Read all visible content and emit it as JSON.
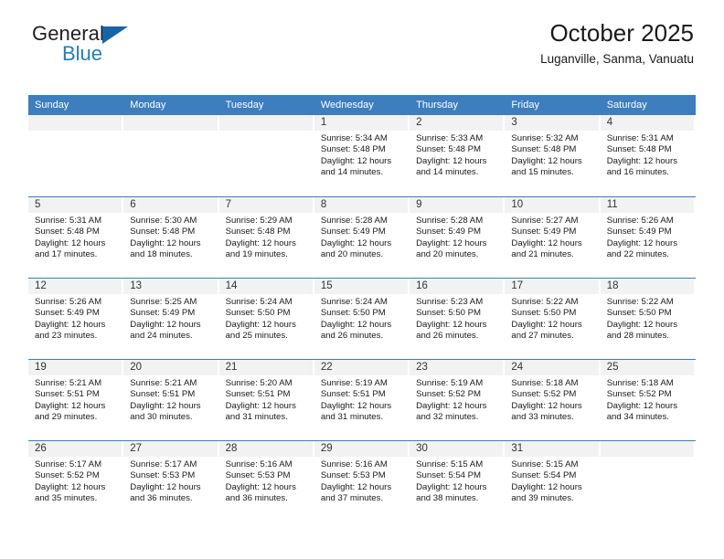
{
  "brand": {
    "name_part1": "General",
    "name_part2": "Blue"
  },
  "header": {
    "title": "October 2025",
    "subtitle": "Luganville, Sanma, Vanuatu"
  },
  "colors": {
    "header_blue": "#3d7ebe",
    "logo_blue": "#1f7ec4",
    "day_strip_gray": "#f2f2f2"
  },
  "weekdays": [
    "Sunday",
    "Monday",
    "Tuesday",
    "Wednesday",
    "Thursday",
    "Friday",
    "Saturday"
  ],
  "weeks": [
    [
      {
        "day": "",
        "empty": true
      },
      {
        "day": "",
        "empty": true
      },
      {
        "day": "",
        "empty": true
      },
      {
        "day": "1",
        "sunrise": "Sunrise: 5:34 AM",
        "sunset": "Sunset: 5:48 PM",
        "daylight1": "Daylight: 12 hours",
        "daylight2": "and 14 minutes."
      },
      {
        "day": "2",
        "sunrise": "Sunrise: 5:33 AM",
        "sunset": "Sunset: 5:48 PM",
        "daylight1": "Daylight: 12 hours",
        "daylight2": "and 14 minutes."
      },
      {
        "day": "3",
        "sunrise": "Sunrise: 5:32 AM",
        "sunset": "Sunset: 5:48 PM",
        "daylight1": "Daylight: 12 hours",
        "daylight2": "and 15 minutes."
      },
      {
        "day": "4",
        "sunrise": "Sunrise: 5:31 AM",
        "sunset": "Sunset: 5:48 PM",
        "daylight1": "Daylight: 12 hours",
        "daylight2": "and 16 minutes."
      }
    ],
    [
      {
        "day": "5",
        "sunrise": "Sunrise: 5:31 AM",
        "sunset": "Sunset: 5:48 PM",
        "daylight1": "Daylight: 12 hours",
        "daylight2": "and 17 minutes."
      },
      {
        "day": "6",
        "sunrise": "Sunrise: 5:30 AM",
        "sunset": "Sunset: 5:48 PM",
        "daylight1": "Daylight: 12 hours",
        "daylight2": "and 18 minutes."
      },
      {
        "day": "7",
        "sunrise": "Sunrise: 5:29 AM",
        "sunset": "Sunset: 5:48 PM",
        "daylight1": "Daylight: 12 hours",
        "daylight2": "and 19 minutes."
      },
      {
        "day": "8",
        "sunrise": "Sunrise: 5:28 AM",
        "sunset": "Sunset: 5:49 PM",
        "daylight1": "Daylight: 12 hours",
        "daylight2": "and 20 minutes."
      },
      {
        "day": "9",
        "sunrise": "Sunrise: 5:28 AM",
        "sunset": "Sunset: 5:49 PM",
        "daylight1": "Daylight: 12 hours",
        "daylight2": "and 20 minutes."
      },
      {
        "day": "10",
        "sunrise": "Sunrise: 5:27 AM",
        "sunset": "Sunset: 5:49 PM",
        "daylight1": "Daylight: 12 hours",
        "daylight2": "and 21 minutes."
      },
      {
        "day": "11",
        "sunrise": "Sunrise: 5:26 AM",
        "sunset": "Sunset: 5:49 PM",
        "daylight1": "Daylight: 12 hours",
        "daylight2": "and 22 minutes."
      }
    ],
    [
      {
        "day": "12",
        "sunrise": "Sunrise: 5:26 AM",
        "sunset": "Sunset: 5:49 PM",
        "daylight1": "Daylight: 12 hours",
        "daylight2": "and 23 minutes."
      },
      {
        "day": "13",
        "sunrise": "Sunrise: 5:25 AM",
        "sunset": "Sunset: 5:49 PM",
        "daylight1": "Daylight: 12 hours",
        "daylight2": "and 24 minutes."
      },
      {
        "day": "14",
        "sunrise": "Sunrise: 5:24 AM",
        "sunset": "Sunset: 5:50 PM",
        "daylight1": "Daylight: 12 hours",
        "daylight2": "and 25 minutes."
      },
      {
        "day": "15",
        "sunrise": "Sunrise: 5:24 AM",
        "sunset": "Sunset: 5:50 PM",
        "daylight1": "Daylight: 12 hours",
        "daylight2": "and 26 minutes."
      },
      {
        "day": "16",
        "sunrise": "Sunrise: 5:23 AM",
        "sunset": "Sunset: 5:50 PM",
        "daylight1": "Daylight: 12 hours",
        "daylight2": "and 26 minutes."
      },
      {
        "day": "17",
        "sunrise": "Sunrise: 5:22 AM",
        "sunset": "Sunset: 5:50 PM",
        "daylight1": "Daylight: 12 hours",
        "daylight2": "and 27 minutes."
      },
      {
        "day": "18",
        "sunrise": "Sunrise: 5:22 AM",
        "sunset": "Sunset: 5:50 PM",
        "daylight1": "Daylight: 12 hours",
        "daylight2": "and 28 minutes."
      }
    ],
    [
      {
        "day": "19",
        "sunrise": "Sunrise: 5:21 AM",
        "sunset": "Sunset: 5:51 PM",
        "daylight1": "Daylight: 12 hours",
        "daylight2": "and 29 minutes."
      },
      {
        "day": "20",
        "sunrise": "Sunrise: 5:21 AM",
        "sunset": "Sunset: 5:51 PM",
        "daylight1": "Daylight: 12 hours",
        "daylight2": "and 30 minutes."
      },
      {
        "day": "21",
        "sunrise": "Sunrise: 5:20 AM",
        "sunset": "Sunset: 5:51 PM",
        "daylight1": "Daylight: 12 hours",
        "daylight2": "and 31 minutes."
      },
      {
        "day": "22",
        "sunrise": "Sunrise: 5:19 AM",
        "sunset": "Sunset: 5:51 PM",
        "daylight1": "Daylight: 12 hours",
        "daylight2": "and 31 minutes."
      },
      {
        "day": "23",
        "sunrise": "Sunrise: 5:19 AM",
        "sunset": "Sunset: 5:52 PM",
        "daylight1": "Daylight: 12 hours",
        "daylight2": "and 32 minutes."
      },
      {
        "day": "24",
        "sunrise": "Sunrise: 5:18 AM",
        "sunset": "Sunset: 5:52 PM",
        "daylight1": "Daylight: 12 hours",
        "daylight2": "and 33 minutes."
      },
      {
        "day": "25",
        "sunrise": "Sunrise: 5:18 AM",
        "sunset": "Sunset: 5:52 PM",
        "daylight1": "Daylight: 12 hours",
        "daylight2": "and 34 minutes."
      }
    ],
    [
      {
        "day": "26",
        "sunrise": "Sunrise: 5:17 AM",
        "sunset": "Sunset: 5:52 PM",
        "daylight1": "Daylight: 12 hours",
        "daylight2": "and 35 minutes."
      },
      {
        "day": "27",
        "sunrise": "Sunrise: 5:17 AM",
        "sunset": "Sunset: 5:53 PM",
        "daylight1": "Daylight: 12 hours",
        "daylight2": "and 36 minutes."
      },
      {
        "day": "28",
        "sunrise": "Sunrise: 5:16 AM",
        "sunset": "Sunset: 5:53 PM",
        "daylight1": "Daylight: 12 hours",
        "daylight2": "and 36 minutes."
      },
      {
        "day": "29",
        "sunrise": "Sunrise: 5:16 AM",
        "sunset": "Sunset: 5:53 PM",
        "daylight1": "Daylight: 12 hours",
        "daylight2": "and 37 minutes."
      },
      {
        "day": "30",
        "sunrise": "Sunrise: 5:15 AM",
        "sunset": "Sunset: 5:54 PM",
        "daylight1": "Daylight: 12 hours",
        "daylight2": "and 38 minutes."
      },
      {
        "day": "31",
        "sunrise": "Sunrise: 5:15 AM",
        "sunset": "Sunset: 5:54 PM",
        "daylight1": "Daylight: 12 hours",
        "daylight2": "and 39 minutes."
      },
      {
        "day": "",
        "empty": true
      }
    ]
  ]
}
